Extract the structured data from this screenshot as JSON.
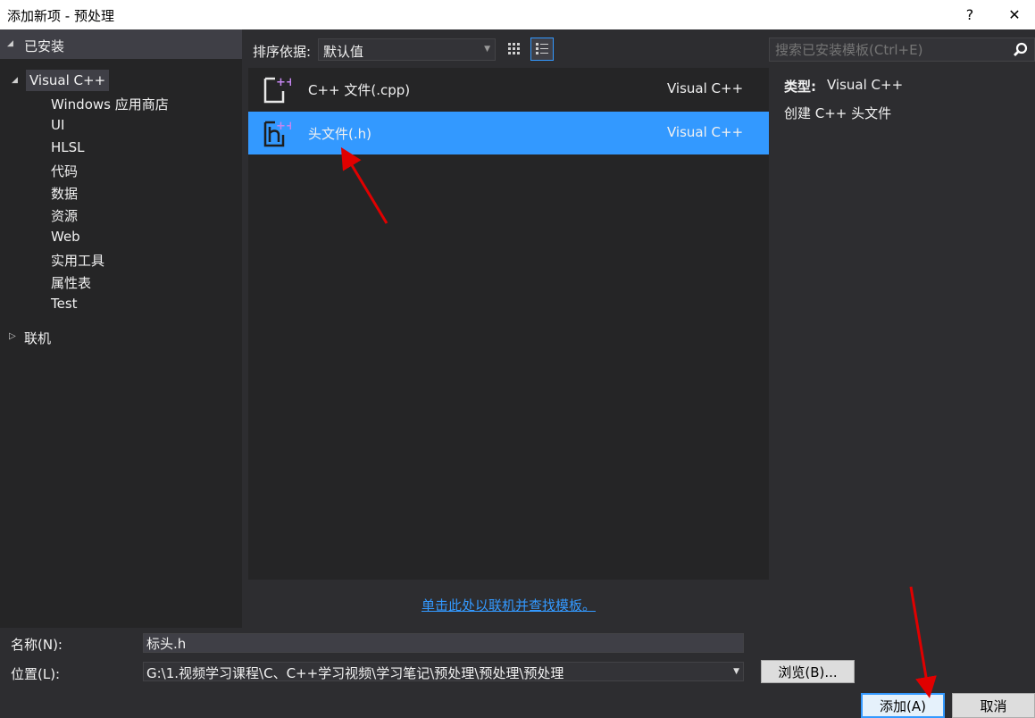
{
  "window": {
    "title": "添加新项 - 预处理",
    "help_glyph": "?",
    "close_glyph": "✕"
  },
  "left": {
    "installed_header": "已安装",
    "root_item": "Visual C++",
    "children": [
      "Windows 应用商店",
      "UI",
      "HLSL",
      "代码",
      "数据",
      "资源",
      "Web",
      "实用工具",
      "属性表",
      "Test"
    ],
    "online_item": "联机"
  },
  "toolbar": {
    "sort_label": "排序依据:",
    "sort_value": "默认值",
    "view_small_icon": "grid-view-icon",
    "view_list_icon": "list-view-icon"
  },
  "templates": [
    {
      "name": "C++ 文件(.cpp)",
      "type": "Visual C++",
      "icon": "cpp-file-icon",
      "selected": false
    },
    {
      "name": "头文件(.h)",
      "type": "Visual C++",
      "icon": "header-file-icon",
      "selected": true
    }
  ],
  "search": {
    "placeholder": "搜索已安装模板(Ctrl+E)",
    "icon": "search-icon"
  },
  "detail": {
    "type_label": "类型:",
    "type_value": "Visual C++",
    "description": "创建 C++ 头文件"
  },
  "online_link": "单击此处以联机并查找模板。",
  "form": {
    "name_label": "名称(N):",
    "name_value": "标头.h",
    "location_label": "位置(L):",
    "location_value": "G:\\1.视频学习课程\\C、C++学习视频\\学习笔记\\预处理\\预处理\\预处理",
    "browse_label": "浏览(B)...",
    "add_label": "添加(A)",
    "cancel_label": "取消"
  },
  "colors": {
    "accent": "#3399ff",
    "annotation_arrow": "#e00000"
  }
}
